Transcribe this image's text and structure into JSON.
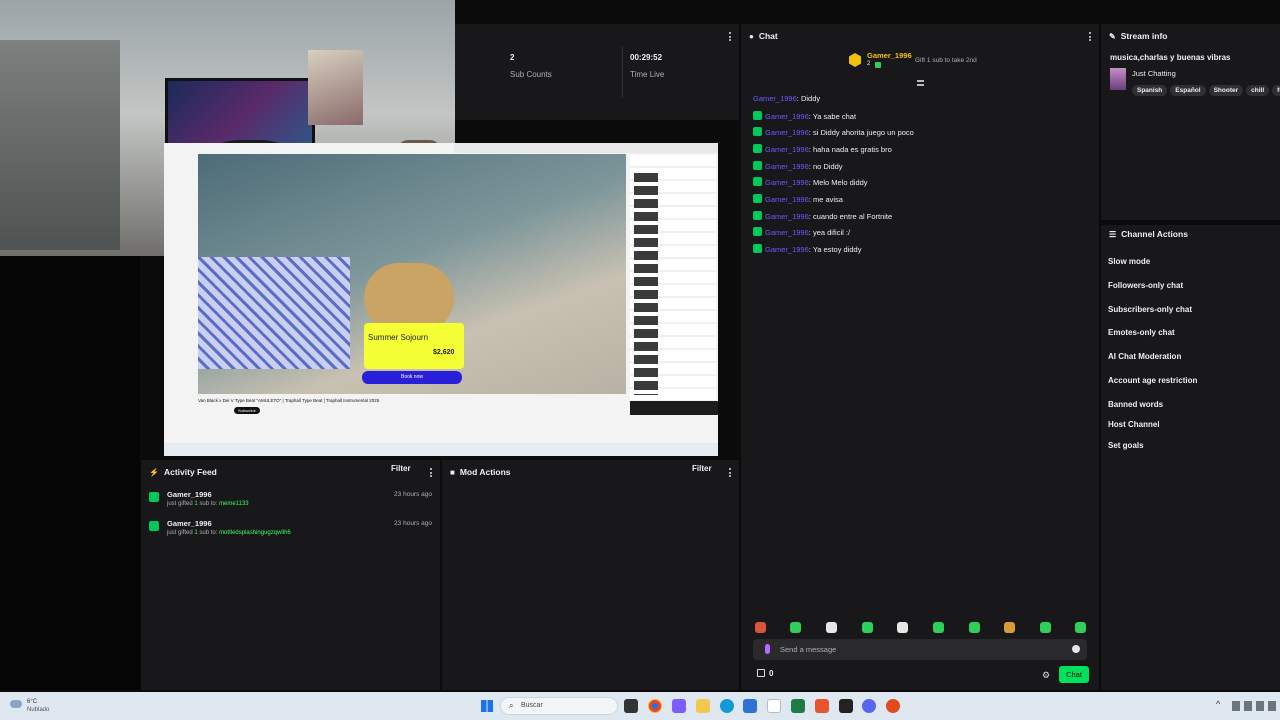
{
  "top_stats": [
    {
      "value": "2",
      "label": "Sub Counts"
    },
    {
      "value": "00:29:52",
      "label": "Time Live"
    }
  ],
  "chat": {
    "title": "Chat",
    "pinned": {
      "user": "Gamer_1996",
      "count": "2",
      "gift_text": "Gift 1 sub to take 2nd"
    },
    "messages": [
      {
        "user": "Gamer_1996",
        "text": ": Diddy",
        "badge": false
      },
      {
        "user": "Gamer_1996",
        "text": ": Ya sabe chat",
        "badge": true
      },
      {
        "user": "Gamer_1996",
        "text": ": si Diddy ahorita juego un poco",
        "badge": true
      },
      {
        "user": "Gamer_1996",
        "text": ": haha nada es gratis bro",
        "badge": true
      },
      {
        "user": "Gamer_1996",
        "text": ": no Diddy",
        "badge": true
      },
      {
        "user": "Gamer_1996",
        "text": ": Melo Melo diddy",
        "badge": true
      },
      {
        "user": "Gamer_1996",
        "text": ": me avisa",
        "badge": true
      },
      {
        "user": "Gamer_1996",
        "text": ": cuando entre al Fortnite",
        "badge": true
      },
      {
        "user": "Gamer_1996",
        "text": ": yea dificil :/",
        "badge": true
      },
      {
        "user": "Gamer_1996",
        "text": ": Ya estoy diddy",
        "badge": true
      }
    ],
    "input_placeholder": "Send a message",
    "points": "0",
    "send_label": "Chat"
  },
  "stream_info": {
    "title": "Stream info",
    "stream_title": "musica,charlas y buenas vibras",
    "category": "Just Chatting",
    "tags": [
      "Spanish",
      "Español",
      "Shooter",
      "chill",
      "fu"
    ]
  },
  "channel_actions": {
    "title": "Channel Actions",
    "items": [
      "Slow mode",
      "Followers-only chat",
      "Subscribers-only chat",
      "Emotes-only chat",
      "AI Chat Moderation",
      "Account age restriction",
      "Banned words",
      "Host Channel",
      "Set goals"
    ]
  },
  "activity_feed": {
    "title": "Activity Feed",
    "filter_label": "Filter",
    "items": [
      {
        "user": "Gamer_1996",
        "pre": "just gifted ",
        "count": "1",
        "mid": " sub to: ",
        "target": "meme1133",
        "time": "23 hours ago"
      },
      {
        "user": "Gamer_1996",
        "pre": "just gifted ",
        "count": "1",
        "mid": " sub to: ",
        "target": "mottledsplashingugzqwilh6",
        "time": "23 hours ago"
      }
    ]
  },
  "mod_actions": {
    "title": "Mod Actions",
    "filter_label": "Filter"
  },
  "video": {
    "ad_title": "Summer Sojourn",
    "ad_old_price": "$2,620",
    "ad_price": "$2,620",
    "ad_cta": "Book now",
    "video_title": "Van Black x Dei V Type Beat \"AMULETO\" | Traphall Type Beat | Traphall Instrumental 2025",
    "subscribe_label": "Subscribe"
  },
  "taskbar": {
    "weather_temp": "6°C",
    "weather_text": "Nublado",
    "search_placeholder": "Buscar"
  },
  "colors": {
    "accent_green": "#00f593",
    "username": "#6b5bff",
    "send_button": "#00e25b"
  }
}
